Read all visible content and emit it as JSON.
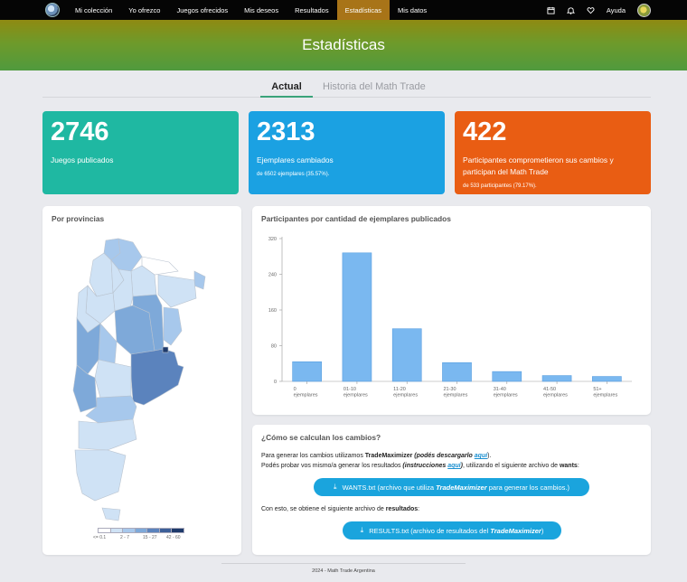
{
  "nav": {
    "items": [
      {
        "label": "Mi colección"
      },
      {
        "label": "Yo ofrezco"
      },
      {
        "label": "Juegos ofrecidos"
      },
      {
        "label": "Mis deseos"
      },
      {
        "label": "Resultados"
      },
      {
        "label": "Estadísticas",
        "active": true
      },
      {
        "label": "Mis datos"
      }
    ],
    "help_label": "Ayuda",
    "icons": [
      "calendar-icon",
      "bell-icon",
      "heart-icon"
    ]
  },
  "page": {
    "title": "Estadísticas"
  },
  "tabs": [
    {
      "label": "Actual",
      "active": true
    },
    {
      "label": "Historia del Math Trade"
    }
  ],
  "stats": [
    {
      "number": "2746",
      "label": "Juegos publicados",
      "sub": "",
      "color": "#1fb8a2"
    },
    {
      "number": "2313",
      "label": "Ejemplares cambiados",
      "sub": "de 6502 ejemplares (35.57%).",
      "color": "#1ba1e2"
    },
    {
      "number": "422",
      "label": "Participantes comprometieron sus cambios y participan del Math Trade",
      "sub": "de 533 participantes (79.17%).",
      "color": "#e95d13"
    }
  ],
  "map": {
    "title": "Por provincias",
    "legend": [
      "<= 0.1",
      "2 - 7",
      "15 - 27",
      "42 - 60"
    ],
    "legend_colors": [
      "#ffffff",
      "#cfe2f5",
      "#a7c8ec",
      "#7ea9d9",
      "#5b83bd",
      "#3c5f98",
      "#1e3a6b"
    ]
  },
  "chart": {
    "title": "Participantes por cantidad de ejemplares publicados"
  },
  "chart_data": {
    "type": "bar",
    "categories": [
      [
        "0",
        "ejemplares"
      ],
      [
        "01-10",
        "ejemplares"
      ],
      [
        "11-20",
        "ejemplares"
      ],
      [
        "21-30",
        "ejemplares"
      ],
      [
        "31-40",
        "ejemplares"
      ],
      [
        "41-50",
        "ejemplares"
      ],
      [
        "51+",
        "ejemplares"
      ]
    ],
    "values": [
      44,
      288,
      118,
      42,
      22,
      13,
      11
    ],
    "yticks": [
      0,
      80,
      160,
      240,
      320
    ],
    "ylim": [
      0,
      320
    ],
    "bar_color": "#7ab8f0",
    "bar_stroke": "#5a9fe0",
    "grid": false
  },
  "how": {
    "title": "¿Cómo se calculan los cambios?",
    "line1_pre": "Para generar los cambios utilizamos ",
    "line1_tool": "TradeMaximizer",
    "line1_paren": " (podés descargarlo ",
    "line1_link": "aquí",
    "line1_end": ").",
    "line2_pre": "Podés probar vos mismo/a generar los resultados ",
    "line2_paren": "(instrucciones ",
    "line2_link": "aquí",
    "line2_mid": ")",
    "line2_post": ", utilizando el siguiente archivo de ",
    "line2_bold": "wants",
    "line2_end": ":",
    "btn1_pre": "WANTS.txt (archivo que utiliza ",
    "btn1_em": "TradeMaximizer",
    "btn1_post": " para generar los cambios.)",
    "line3_pre": "Con esto, se obtiene el siguiente archivo de ",
    "line3_bold": "resultados",
    "line3_end": ":",
    "btn2_pre": "RESULTS.txt (archivo de resultados del ",
    "btn2_em": "TradeMaximizer",
    "btn2_post": ")"
  },
  "footer": "2024 - Math Trade Argentina"
}
